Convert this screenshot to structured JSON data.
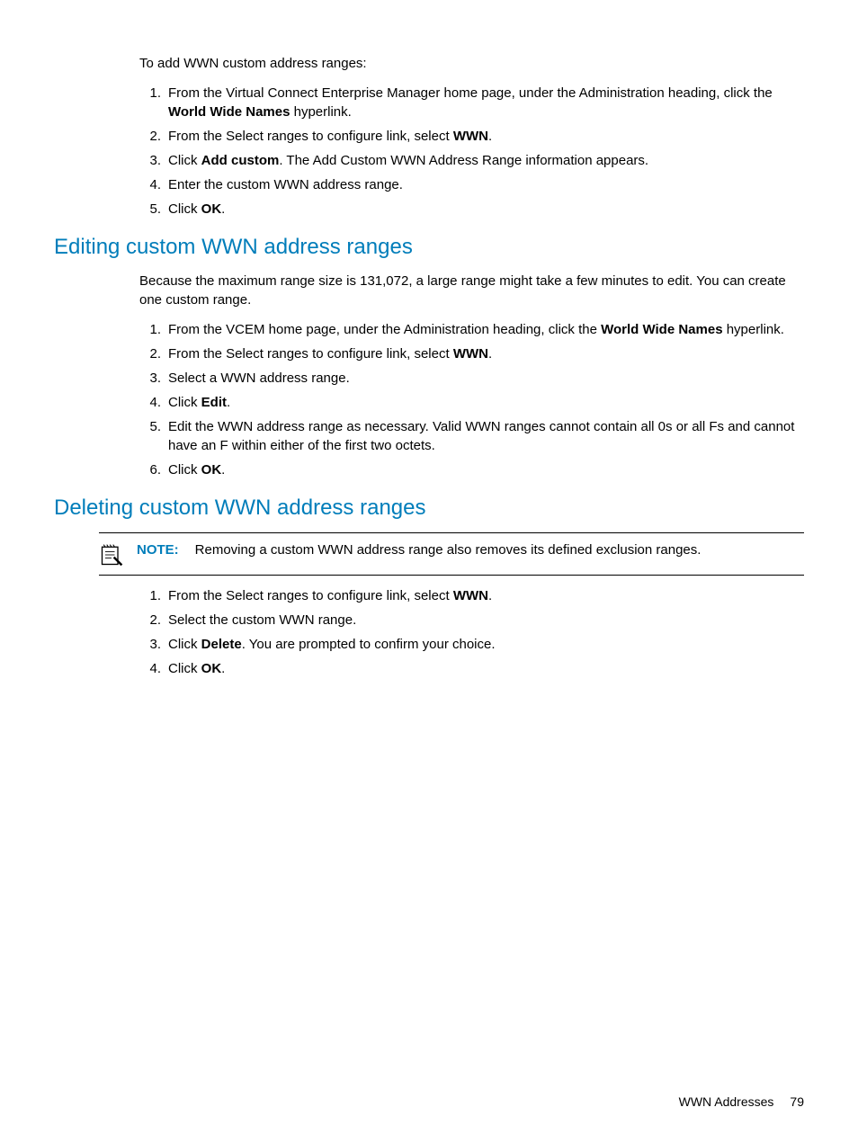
{
  "section0": {
    "intro": "To add WWN custom address ranges:",
    "steps": [
      {
        "pre": "From the Virtual Connect Enterprise Manager home page, under the Administration heading, click the ",
        "bold": "World Wide Names",
        "post": " hyperlink."
      },
      {
        "pre": "From the Select ranges to configure link, select ",
        "bold": "WWN",
        "post": "."
      },
      {
        "pre": "Click ",
        "bold": "Add custom",
        "post": ". The Add Custom WWN Address Range information appears."
      },
      {
        "pre": "Enter the custom WWN address range.",
        "bold": "",
        "post": ""
      },
      {
        "pre": "Click ",
        "bold": "OK",
        "post": "."
      }
    ]
  },
  "section1": {
    "heading": "Editing custom WWN address ranges",
    "intro": "Because the maximum range size is 131,072, a large range might take a few minutes to edit. You can create one custom range.",
    "steps": [
      {
        "pre": "From the VCEM home page, under the Administration heading, click the ",
        "bold": "World Wide Names",
        "post": " hyperlink."
      },
      {
        "pre": "From the Select ranges to configure link, select ",
        "bold": "WWN",
        "post": "."
      },
      {
        "pre": "Select a WWN address range.",
        "bold": "",
        "post": ""
      },
      {
        "pre": "Click ",
        "bold": "Edit",
        "post": "."
      },
      {
        "pre": "Edit the WWN address range as necessary. Valid WWN ranges cannot contain all 0s or all Fs and cannot have an F within either of the first two octets.",
        "bold": "",
        "post": ""
      },
      {
        "pre": "Click ",
        "bold": "OK",
        "post": "."
      }
    ]
  },
  "section2": {
    "heading": "Deleting custom WWN address ranges",
    "note_label": "NOTE:",
    "note_text": "Removing a custom WWN address range also removes its defined exclusion ranges.",
    "steps": [
      {
        "pre": "From the Select ranges to configure link, select ",
        "bold": "WWN",
        "post": "."
      },
      {
        "pre": "Select the custom WWN range.",
        "bold": "",
        "post": ""
      },
      {
        "pre": "Click ",
        "bold": "Delete",
        "post": ". You are prompted to confirm your choice."
      },
      {
        "pre": "Click ",
        "bold": "OK",
        "post": "."
      }
    ]
  },
  "footer": {
    "title": "WWN Addresses",
    "page": "79"
  }
}
